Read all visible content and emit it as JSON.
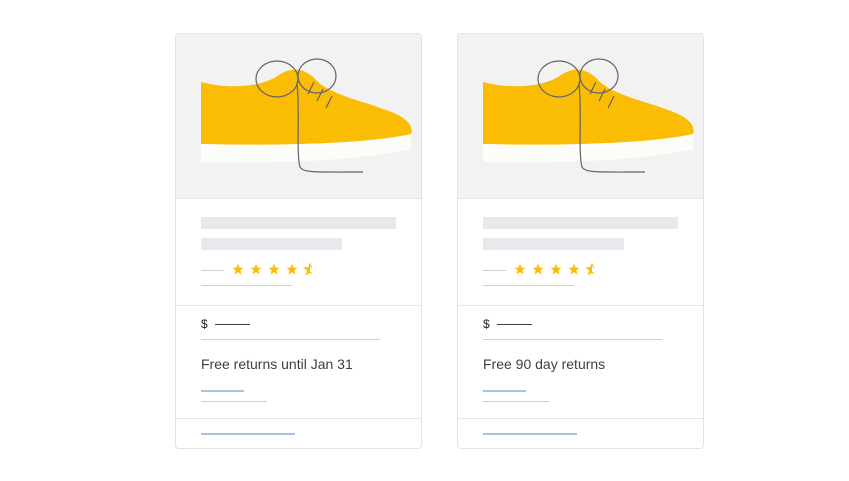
{
  "colors": {
    "shoe": "#fbbc04",
    "sole": "#fcfcf8",
    "lace": "#5f6368",
    "star": "#fbbc04",
    "placeholder": "#e8e9ec",
    "link_placeholder": "#a7c4e8"
  },
  "cards": [
    {
      "image_icon": "shoe-illustration",
      "rating": 4.5,
      "price_symbol": "$",
      "returns_text": "Free returns until Jan 31"
    },
    {
      "image_icon": "shoe-illustration",
      "rating": 4.5,
      "price_symbol": "$",
      "returns_text": "Free 90 day returns"
    }
  ]
}
